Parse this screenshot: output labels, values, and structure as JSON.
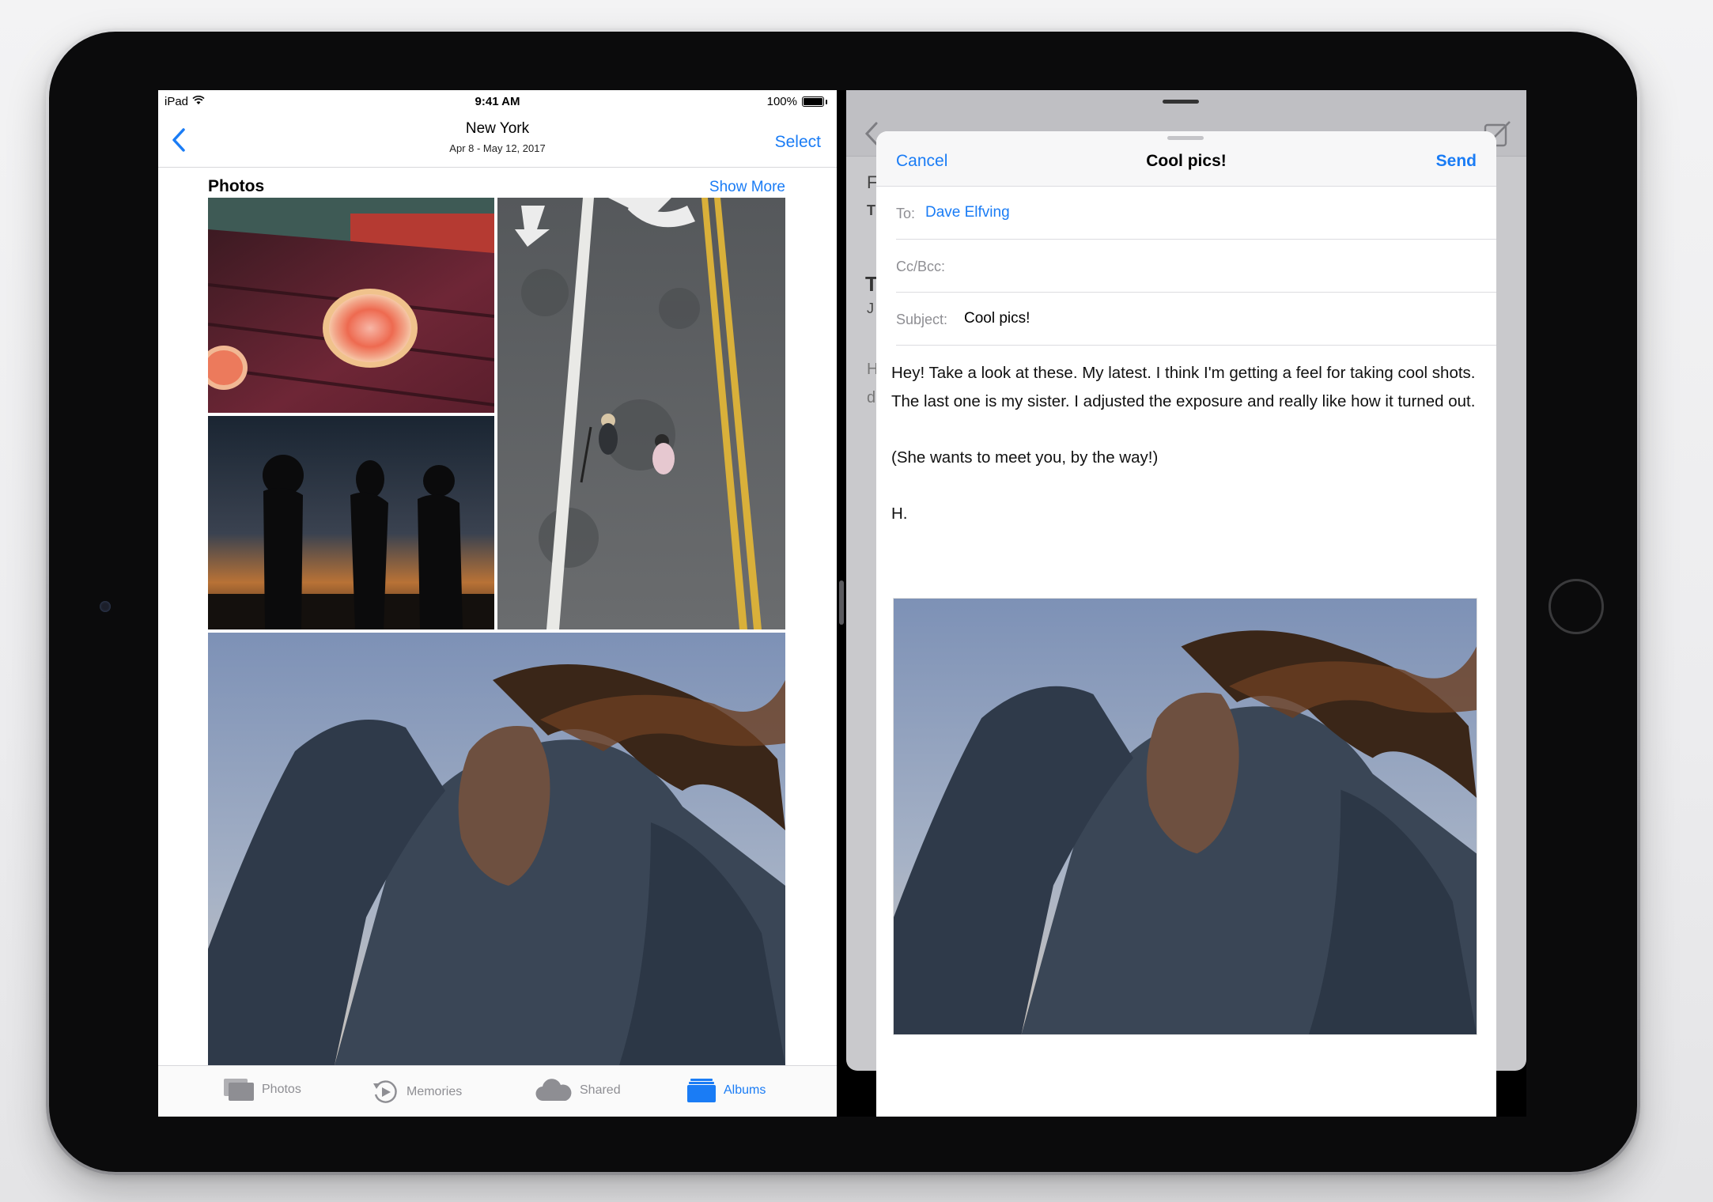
{
  "status_bar": {
    "carrier": "iPad",
    "time": "9:41 AM",
    "battery": "100%"
  },
  "photos_nav": {
    "title": "New York",
    "subtitle": "Apr 8 - May 12, 2017",
    "select_label": "Select"
  },
  "photos_section": {
    "title": "Photos",
    "show_more_label": "Show More"
  },
  "tab_bar": {
    "items": [
      {
        "label": "Photos",
        "icon": "photos-icon"
      },
      {
        "label": "Memories",
        "icon": "memories-icon"
      },
      {
        "label": "Shared",
        "icon": "cloud-icon"
      },
      {
        "label": "Albums",
        "icon": "albums-icon"
      }
    ],
    "active": "Albums"
  },
  "compose": {
    "cancel_label": "Cancel",
    "title": "Cool pics!",
    "send_label": "Send",
    "to_label": "To:",
    "to_value": "Dave Elfving",
    "ccbcc_label": "Cc/Bcc:",
    "subject_label": "Subject:",
    "subject_value": "Cool pics!",
    "body_paragraph_1": "Hey! Take a look at these. My latest. I think I'm getting a feel for taking cool shots. The last one is my sister. I adjusted the exposure and really like how it turned out.",
    "body_paragraph_2": "(She wants to meet you, by the way!)",
    "signature": "H."
  },
  "mail_background": {
    "peek_letters": [
      "F",
      "T",
      "T",
      "J",
      "H",
      "d"
    ]
  },
  "colors": {
    "accent": "#1a7cf5",
    "inactive_tab": "#8e8e93",
    "separator": "#dcdce0"
  }
}
